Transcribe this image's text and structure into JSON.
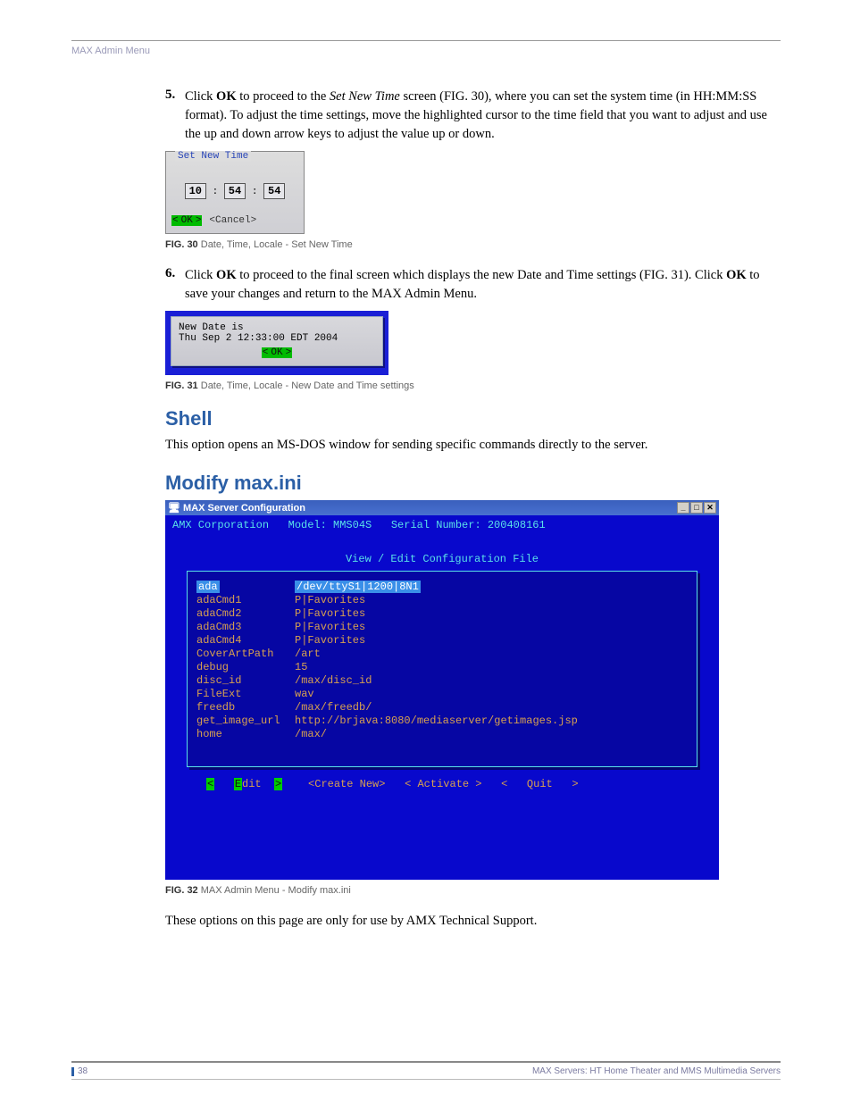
{
  "header": "MAX Admin Menu",
  "step5": {
    "num": "5.",
    "pre": "Click ",
    "bold1": "OK",
    "mid1": " to proceed to the ",
    "ital": "Set New Time",
    "mid2": " screen (FIG. 30), where you can set the system time (in HH:MM:SS format). To adjust the time settings, move the highlighted cursor to the time field that you want to adjust and use the up and down arrow keys to adjust the value up or down."
  },
  "fig30": {
    "legend": "Set New Time",
    "hh": "10",
    "mm": "54",
    "ss": "54",
    "ok": "OK",
    "cancel": "<Cancel>",
    "caption_b": "FIG. 30",
    "caption": "  Date, Time, Locale - Set New Time"
  },
  "step6": {
    "num": "6.",
    "pre": "Click ",
    "bold1": "OK",
    "mid1": " to proceed to the final screen which displays the new Date and Time settings (FIG. 31). Click ",
    "bold2": "OK",
    "mid2": " to save your changes and return to the MAX Admin Menu."
  },
  "fig31": {
    "line1": "New Date is",
    "line2": "Thu Sep  2 12:33:00 EDT 2004",
    "ok": "OK",
    "caption_b": "FIG. 31",
    "caption": "  Date, Time, Locale - New Date and Time settings"
  },
  "shell": {
    "heading": "Shell",
    "body": "This option opens an MS-DOS window for sending specific commands directly to the server."
  },
  "modify": {
    "heading": "Modify max.ini"
  },
  "fig32": {
    "winTitle": "MAX Server Configuration",
    "hdr": "AMX Corporation   Model: MMS04S   Serial Number: 200408161",
    "title2": "View / Edit Configuration File",
    "rows": [
      {
        "k": "ada",
        "v": "/dev/ttyS1|1200|8N1",
        "sel": true
      },
      {
        "k": "adaCmd1",
        "v": "P|Favorites"
      },
      {
        "k": "adaCmd2",
        "v": "P|Favorites"
      },
      {
        "k": "adaCmd3",
        "v": "P|Favorites"
      },
      {
        "k": "adaCmd4",
        "v": "P|Favorites"
      },
      {
        "k": "CoverArtPath",
        "v": "/art"
      },
      {
        "k": "debug",
        "v": "15"
      },
      {
        "k": "disc_id",
        "v": "/max/disc_id"
      },
      {
        "k": "FileExt",
        "v": "wav"
      },
      {
        "k": "freedb",
        "v": "/max/freedb/"
      },
      {
        "k": "get_image_url",
        "v": "http://brjava:8080/mediaserver/getimages.jsp"
      },
      {
        "k": "home",
        "v": "/max/"
      }
    ],
    "btn_edit": "Edit",
    "btn_create": "<Create New>",
    "btn_activate": "< Activate >",
    "btn_quit": "Quit",
    "caption_b": "FIG. 32",
    "caption": "  MAX Admin Menu - Modify max.ini"
  },
  "bottom_p": "These options on this page are only for use by AMX Technical Support.",
  "footer": {
    "page": "38",
    "right": "MAX Servers: HT Home Theater and MMS Multimedia Servers"
  }
}
